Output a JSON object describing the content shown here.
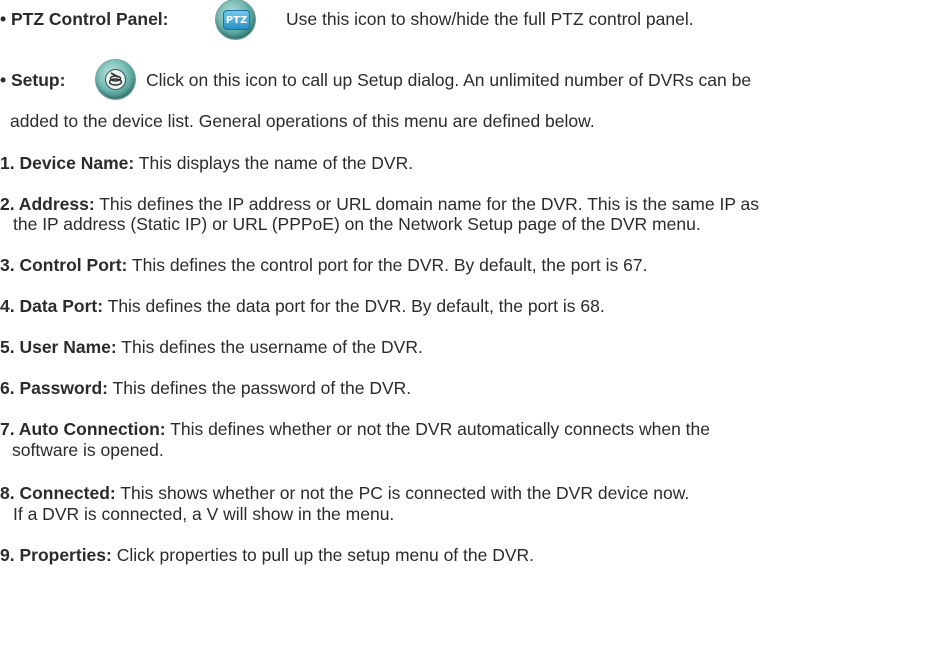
{
  "ptz": {
    "label": "• PTZ Control Panel:",
    "icon_text": "PTZ",
    "icon": "ptz-control-icon",
    "description": "Use this icon to show/hide the full PTZ control panel."
  },
  "setup": {
    "label": "• Setup:",
    "icon": "setup-icon",
    "description_line1": "Click on this icon to call up Setup dialog. An unlimited number of DVRs can be",
    "description_line2": "added to the device list. General operations of this menu are defined below."
  },
  "items": [
    {
      "label": "1. Device Name:",
      "lines": [
        "This displays the name of the DVR."
      ]
    },
    {
      "label": "2. Address:",
      "lines": [
        "This defines the IP address or URL domain name for the DVR. This is the same IP as",
        "the IP address (Static IP) or URL (PPPoE) on the Network Setup page of the DVR menu."
      ]
    },
    {
      "label": "3. Control Port:",
      "lines": [
        "This defines the control port for the DVR.  By default, the port is 67."
      ]
    },
    {
      "label": "4. Data Port:",
      "lines": [
        "This defines the data port for the DVR.  By default, the port is 68."
      ]
    },
    {
      "label": "5. User Name:",
      "lines": [
        "This defines the username of the DVR."
      ]
    },
    {
      "label": "6. Password:",
      "lines": [
        "This defines the password of the DVR."
      ]
    },
    {
      "label": "7. Auto Connection:",
      "lines": [
        "This defines whether or not the DVR automatically connects when the",
        "software is opened."
      ]
    },
    {
      "label": "8. Connected:",
      "lines": [
        "This shows whether or not the PC is connected with the DVR device now.",
        "If a DVR is connected, a V will show in the menu."
      ]
    },
    {
      "label": "9. Properties:",
      "lines": [
        "Click properties to pull up the setup menu of the DVR."
      ]
    }
  ]
}
